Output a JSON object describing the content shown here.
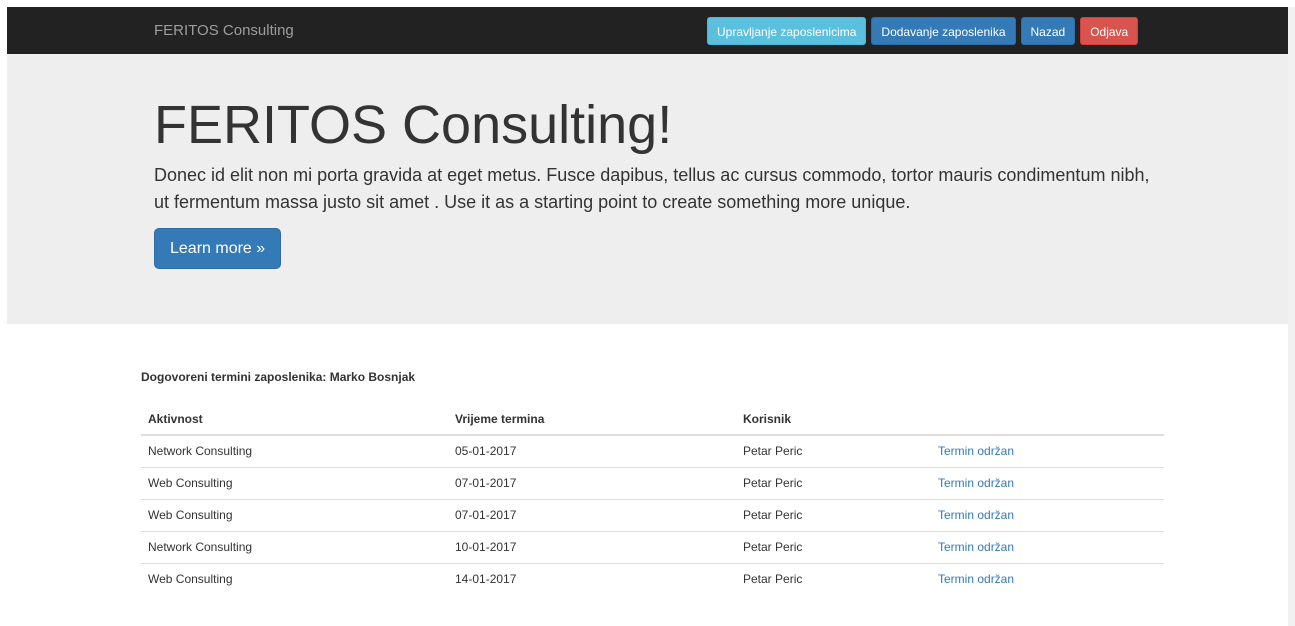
{
  "navbar": {
    "brand": "FERITOS Consulting",
    "buttons": [
      {
        "label": "Upravljanje zaposlenicima",
        "style": "info"
      },
      {
        "label": "Dodavanje zaposlenika",
        "style": "primary"
      },
      {
        "label": "Nazad",
        "style": "primary"
      },
      {
        "label": "Odjava",
        "style": "danger"
      }
    ]
  },
  "jumbotron": {
    "title": "FERITOS Consulting!",
    "text": "Donec id elit non mi porta gravida at eget metus. Fusce dapibus, tellus ac cursus commodo, tortor mauris condimentum nibh, ut fermentum massa justo sit amet . Use it as a starting point to create something more unique.",
    "button_label": "Learn more »"
  },
  "appointments": {
    "title": "Dogovoreni termini zaposlenika: Marko Bosnjak",
    "headers": [
      "Aktivnost",
      "Vrijeme termina",
      "Korisnik",
      ""
    ],
    "rows": [
      {
        "activity": "Network Consulting",
        "date": "05-01-2017",
        "user": "Petar Peric",
        "action": "Termin održan"
      },
      {
        "activity": "Web Consulting",
        "date": "07-01-2017",
        "user": "Petar Peric",
        "action": "Termin održan"
      },
      {
        "activity": "Web Consulting",
        "date": "07-01-2017",
        "user": "Petar Peric",
        "action": "Termin održan"
      },
      {
        "activity": "Network Consulting",
        "date": "10-01-2017",
        "user": "Petar Peric",
        "action": "Termin održan"
      },
      {
        "activity": "Web Consulting",
        "date": "14-01-2017",
        "user": "Petar Peric",
        "action": "Termin održan"
      }
    ]
  },
  "colors": {
    "navbar_bg": "#222222",
    "info": "#5bc0de",
    "primary": "#337ab7",
    "danger": "#d9534f",
    "jumbotron_bg": "#eeeeee"
  }
}
